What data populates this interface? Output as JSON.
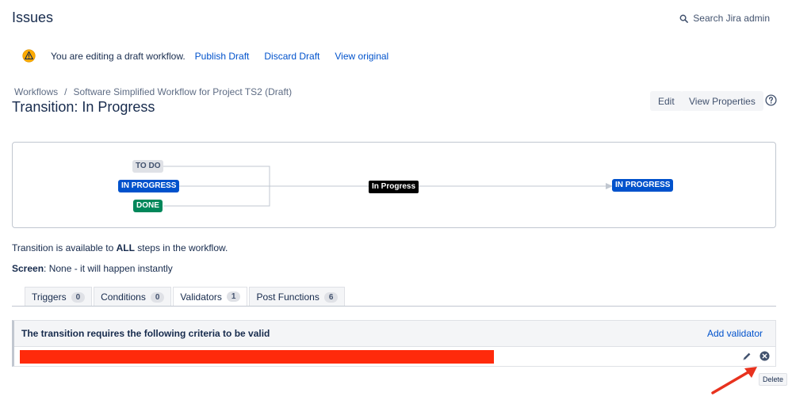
{
  "header": {
    "title": "Issues",
    "search_label": "Search Jira admin"
  },
  "draft_bar": {
    "message": "You are editing a draft workflow.",
    "publish_label": "Publish Draft",
    "discard_label": "Discard Draft",
    "view_original_label": "View original"
  },
  "breadcrumb": {
    "items": [
      "Workflows",
      "Software Simplified Workflow for Project TS2 (Draft)"
    ],
    "separator": "/"
  },
  "transition": {
    "title": "Transition: In Progress",
    "edit_label": "Edit",
    "view_properties_label": "View Properties"
  },
  "diagram": {
    "from_statuses": [
      "TO DO",
      "IN PROGRESS",
      "DONE"
    ],
    "transition_name": "In Progress",
    "to_status": "IN PROGRESS"
  },
  "info": {
    "availability_prefix": "Transition is available to ",
    "availability_bold": "ALL",
    "availability_suffix": " steps in the workflow.",
    "screen_label": "Screen",
    "screen_value": ": None - it will happen instantly"
  },
  "tabs": [
    {
      "label": "Triggers",
      "count": "0"
    },
    {
      "label": "Conditions",
      "count": "0"
    },
    {
      "label": "Validators",
      "count": "1"
    },
    {
      "label": "Post Functions",
      "count": "6"
    }
  ],
  "validators": {
    "header": "The transition requires the following criteria to be valid",
    "add_label": "Add validator",
    "tooltip": "Delete"
  },
  "colors": {
    "link": "#0052CC",
    "text": "#172B4D",
    "redaction": "#FF2A0B",
    "annotation_arrow": "#E8321E"
  },
  "icons": [
    "search-icon",
    "warning-icon",
    "help-icon",
    "pencil-icon",
    "delete-icon"
  ]
}
